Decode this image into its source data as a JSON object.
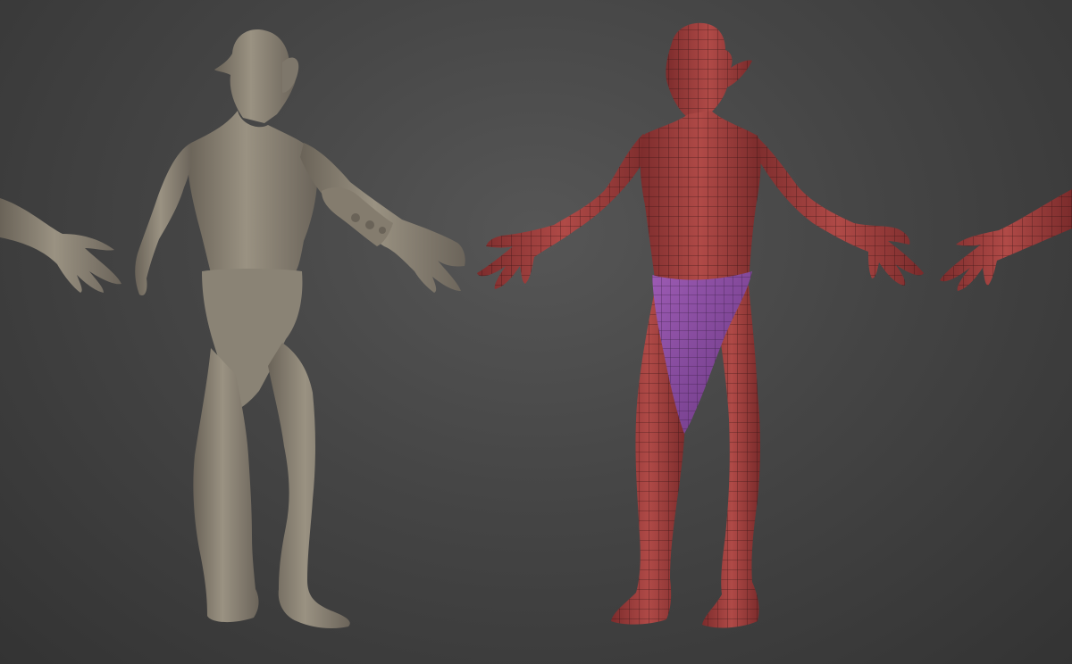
{
  "viewport": {
    "background_center": "#565656",
    "background_edge": "#333333"
  },
  "models": [
    {
      "name": "sculpt-back-view",
      "material": "clay",
      "color": "#8e8678",
      "shadow": "#5e584f",
      "highlight": "#b3ab9c"
    },
    {
      "name": "topology-front-view",
      "material": "wireframe-red",
      "color": "#a8403f",
      "shadow": "#6e2526",
      "wire": "#2a0f10"
    },
    {
      "name": "loincloth",
      "material": "wireframe-purple",
      "color": "#8e4fa6",
      "shadow": "#5c2f70",
      "wire": "#2b1433"
    }
  ]
}
